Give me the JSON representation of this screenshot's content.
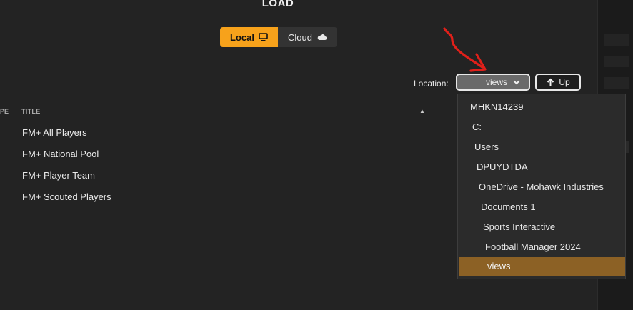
{
  "header": {
    "title": "LOAD"
  },
  "source_toggle": {
    "local_label": "Local",
    "cloud_label": "Cloud",
    "selected": "Local"
  },
  "location": {
    "label": "Location:",
    "current": "views",
    "up_label": "Up"
  },
  "table": {
    "columns": [
      "PE",
      "TITLE"
    ],
    "rows": [
      "FM+ All Players",
      "FM+ National Pool",
      "FM+ Player Team",
      "FM+ Scouted Players"
    ]
  },
  "dropdown": {
    "items": [
      "MHKN14239",
      "C:",
      "Users",
      "DPUYDTDA",
      "OneDrive - Mohawk Industries",
      "Documents 1",
      "Sports Interactive",
      "Football Manager 2024",
      "views"
    ],
    "selected": "views"
  },
  "colors": {
    "accent": "#f7a21b",
    "selected_item": "#8c6125",
    "annotation": "#e0201a"
  }
}
